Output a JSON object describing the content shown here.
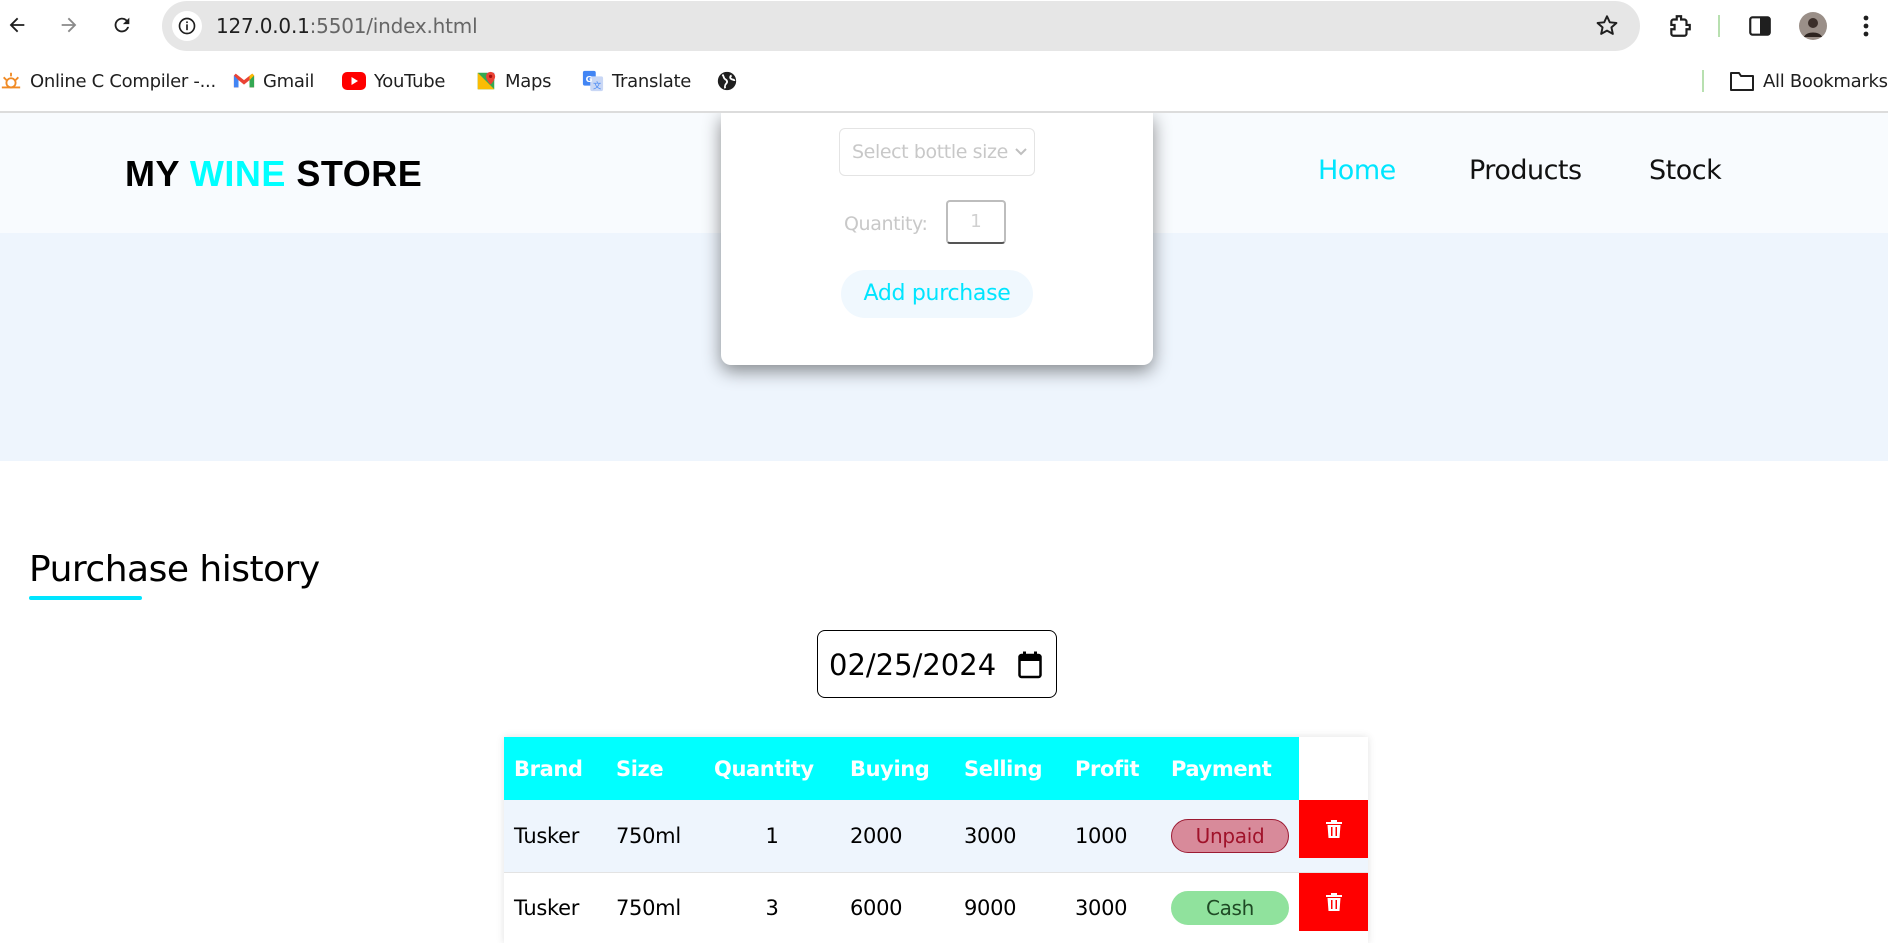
{
  "browser": {
    "url_host": "127.0.0.1",
    "url_rest": ":5501/index.html",
    "bookmarks": [
      {
        "label": "Online C Compiler -...",
        "icon": "compiler-icon"
      },
      {
        "label": "Gmail",
        "icon": "gmail-icon"
      },
      {
        "label": "YouTube",
        "icon": "youtube-icon"
      },
      {
        "label": "Maps",
        "icon": "maps-icon"
      },
      {
        "label": "Translate",
        "icon": "translate-icon"
      },
      {
        "label": "",
        "icon": "globe-icon"
      }
    ],
    "all_bookmarks": "All Bookmarks"
  },
  "site": {
    "logo_part1": "MY ",
    "logo_accent": "WINE",
    "logo_part2": " STORE",
    "accent_color": "#00ffff",
    "nav": [
      {
        "label": "Home",
        "active": true
      },
      {
        "label": "Products",
        "active": false
      },
      {
        "label": "Stock",
        "active": false
      }
    ]
  },
  "modal": {
    "select_placeholder": "Select bottle size",
    "quantity_label": "Quantity:",
    "quantity_value": "1",
    "add_button": "Add purchase"
  },
  "history": {
    "title": "Purchase history",
    "date": "02/25/2024",
    "columns": [
      "Brand",
      "Size",
      "Quantity",
      "Buying",
      "Selling",
      "Profit",
      "Payment"
    ],
    "rows": [
      {
        "brand": "Tusker",
        "size": "750ml",
        "quantity": "1",
        "buying": "2000",
        "selling": "3000",
        "profit": "1000",
        "payment": "Unpaid",
        "status_color": "#d88a9a"
      },
      {
        "brand": "Tusker",
        "size": "750ml",
        "quantity": "3",
        "buying": "6000",
        "selling": "9000",
        "profit": "3000",
        "payment": "Cash",
        "status_color": "#90e29d"
      }
    ]
  }
}
